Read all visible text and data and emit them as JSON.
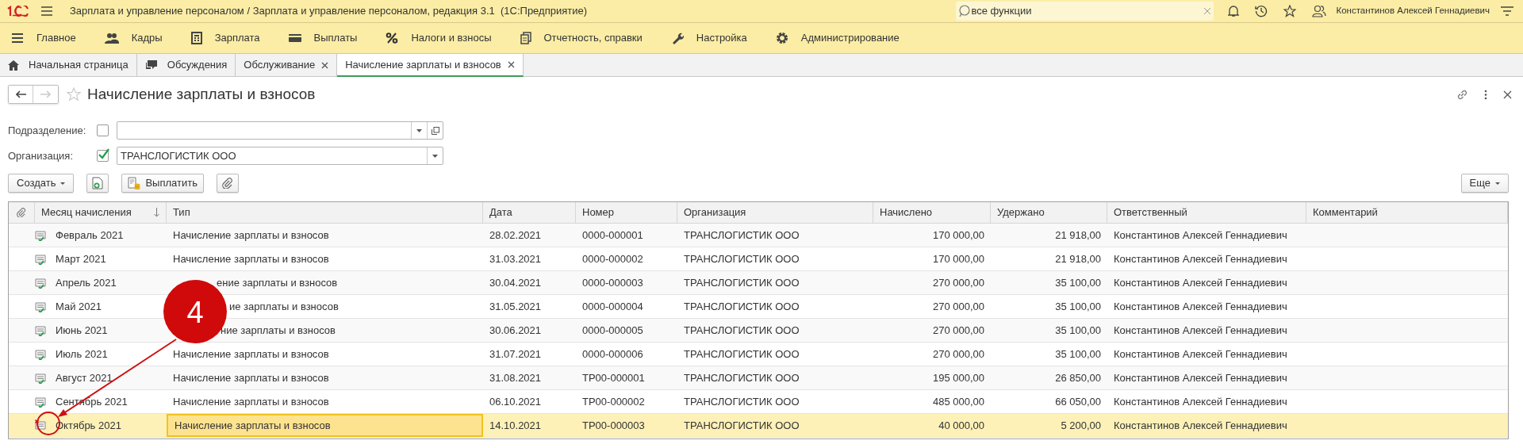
{
  "window": {
    "title": "Зарплата и управление персоналом / Зарплата и управление персоналом, редакция 3.1  (1С:Предприятие)",
    "search": {
      "value": "все функции"
    },
    "user": "Константинов Алексей Геннадиевич"
  },
  "sections": [
    {
      "label": "Главное",
      "kind": "menu"
    },
    {
      "label": "Кадры",
      "kind": "people"
    },
    {
      "label": "Зарплата",
      "kind": "calc"
    },
    {
      "label": "Выплаты",
      "kind": "card"
    },
    {
      "label": "Налоги и взносы",
      "kind": "percent"
    },
    {
      "label": "Отчетность, справки",
      "kind": "docs"
    },
    {
      "label": "Настройка",
      "kind": "wrench"
    },
    {
      "label": "Администрирование",
      "kind": "gear"
    }
  ],
  "tabs": [
    {
      "label": "Начальная страница",
      "kind": "home",
      "closable": false,
      "selected": false
    },
    {
      "label": "Обсуждения",
      "kind": "chat",
      "closable": false,
      "selected": false
    },
    {
      "label": "Обслуживание",
      "kind": "plain",
      "closable": true,
      "selected": false
    },
    {
      "label": "Начисление зарплаты и взносов",
      "kind": "plain",
      "closable": true,
      "selected": true
    }
  ],
  "form": {
    "title": "Начисление зарплаты и взносов",
    "filters": [
      {
        "label": "Подразделение:",
        "checked": false,
        "open_button": true
      },
      {
        "label": "Организация:",
        "checked": true,
        "value": "ТРАНСЛОГИСТИК ООО",
        "open_button": false
      }
    ],
    "buttons": [
      {
        "kind": "dropdown",
        "label": "Создать"
      },
      {
        "kind": "add-doc"
      },
      {
        "kind": "pay",
        "label": "Выплатить"
      },
      {
        "kind": "clip"
      }
    ],
    "more_button": "Еще"
  },
  "table": {
    "columns": [
      "Месяц начисления",
      "Тип",
      "Дата",
      "Номер",
      "Организация",
      "Начислено",
      "Удержано",
      "Ответственный",
      "Комментарий"
    ],
    "rows": [
      {
        "deleted": false,
        "selected": false,
        "cells": [
          "Февраль 2021",
          "Начисление зарплаты и взносов",
          "28.02.2021",
          "0000-000001",
          "ТРАНСЛОГИСТИК ООО",
          "170 000,00",
          "21 918,00",
          "Константинов Алексей Геннадиевич"
        ]
      },
      {
        "deleted": false,
        "selected": false,
        "cells": [
          "Март 2021",
          "Начисление зарплаты и взносов",
          "31.03.2021",
          "0000-000002",
          "ТРАНСЛОГИСТИК ООО",
          "170 000,00",
          "21 918,00",
          "Константинов Алексей Геннадиевич"
        ]
      },
      {
        "deleted": false,
        "selected": false,
        "cells": [
          "Апрель 2021",
          "ение зарплаты и взносов",
          "30.04.2021",
          "0000-000003",
          "ТРАНСЛОГИСТИК ООО",
          "270 000,00",
          "35 100,00",
          "Константинов Алексей Геннадиевич"
        ]
      },
      {
        "deleted": false,
        "selected": false,
        "cells": [
          "Май 2021",
          "ие зарплаты и взносов",
          "31.05.2021",
          "0000-000004",
          "ТРАНСЛОГИСТИК ООО",
          "270 000,00",
          "35 100,00",
          "Константинов Алексей Геннадиевич"
        ]
      },
      {
        "deleted": false,
        "selected": false,
        "cells": [
          "Июнь 2021",
          "ние зарплаты и взносов",
          "30.06.2021",
          "0000-000005",
          "ТРАНСЛОГИСТИК ООО",
          "270 000,00",
          "35 100,00",
          "Константинов Алексей Геннадиевич"
        ]
      },
      {
        "deleted": false,
        "selected": false,
        "cells": [
          "Июль 2021",
          "Начисление зарплаты и взносов",
          "31.07.2021",
          "0000-000006",
          "ТРАНСЛОГИСТИК ООО",
          "270 000,00",
          "35 100,00",
          "Константинов Алексей Геннадиевич"
        ]
      },
      {
        "deleted": false,
        "selected": false,
        "cells": [
          "Август 2021",
          "Начисление зарплаты и взносов",
          "31.08.2021",
          "ТР00-000001",
          "ТРАНСЛОГИСТИК ООО",
          "195 000,00",
          "26 850,00",
          "Константинов Алексей Геннадиевич"
        ]
      },
      {
        "deleted": false,
        "selected": false,
        "cells": [
          "Сентябрь 2021",
          "Начисление зарплаты и взносов",
          "06.10.2021",
          "ТР00-000002",
          "ТРАНСЛОГИСТИК ООО",
          "485 000,00",
          "66 050,00",
          "Константинов Алексей Геннадиевич"
        ]
      },
      {
        "deleted": true,
        "selected": true,
        "cells": [
          "Октябрь 2021",
          "Начисление зарплаты и взносов",
          "14.10.2021",
          "ТР00-000003",
          "ТРАНСЛОГИСТИК ООО",
          "40 000,00",
          "5 200,00",
          "Константинов Алексей Геннадиевич"
        ]
      }
    ]
  },
  "callout": {
    "label": "4"
  }
}
